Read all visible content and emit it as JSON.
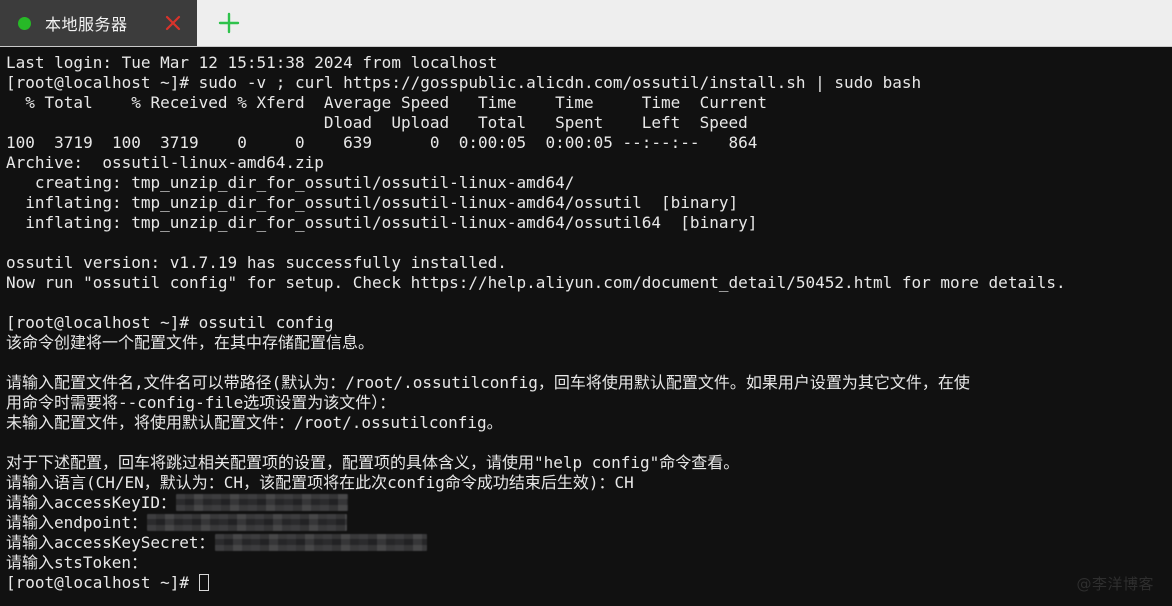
{
  "window": {
    "tab": {
      "title": "本地服务器",
      "status_dot_color": "#27b927",
      "close_label": "×",
      "new_tab_label": "+"
    }
  },
  "theme": {
    "tab_bar_bg": "#eeeeee",
    "active_tab_bg": "#3c3c3c",
    "terminal_bg": "#111111",
    "terminal_fg": "#e8e8e8",
    "close_icon_color": "#d9332b",
    "new_tab_icon_color": "#2ec24b"
  },
  "terminal": {
    "lines": [
      {
        "id": "l01",
        "text": "Last login: Tue Mar 12 15:51:38 2024 from localhost"
      },
      {
        "id": "l02",
        "text": "[root@localhost ~]# sudo -v ; curl https://gosspublic.alicdn.com/ossutil/install.sh | sudo bash"
      },
      {
        "id": "l03",
        "text": "  % Total    % Received % Xferd  Average Speed   Time    Time     Time  Current"
      },
      {
        "id": "l04",
        "text": "                                 Dload  Upload   Total   Spent    Left  Speed"
      },
      {
        "id": "l05",
        "text": "100  3719  100  3719    0     0    639      0  0:00:05  0:00:05 --:--:--   864"
      },
      {
        "id": "l06",
        "text": "Archive:  ossutil-linux-amd64.zip"
      },
      {
        "id": "l07",
        "text": "   creating: tmp_unzip_dir_for_ossutil/ossutil-linux-amd64/"
      },
      {
        "id": "l08",
        "text": "  inflating: tmp_unzip_dir_for_ossutil/ossutil-linux-amd64/ossutil  [binary]"
      },
      {
        "id": "l09",
        "text": "  inflating: tmp_unzip_dir_for_ossutil/ossutil-linux-amd64/ossutil64  [binary]"
      },
      {
        "id": "l10",
        "text": ""
      },
      {
        "id": "l11",
        "text": "ossutil version: v1.7.19 has successfully installed."
      },
      {
        "id": "l12",
        "text": "Now run \"ossutil config\" for setup. Check https://help.aliyun.com/document_detail/50452.html for more details."
      },
      {
        "id": "l13",
        "text": ""
      },
      {
        "id": "l14",
        "text": "[root@localhost ~]# ossutil config"
      },
      {
        "id": "l15",
        "text": "该命令创建将一个配置文件，在其中存储配置信息。"
      },
      {
        "id": "l16",
        "text": ""
      },
      {
        "id": "l17",
        "text": "请输入配置文件名,文件名可以带路径(默认为：/root/.ossutilconfig，回车将使用默认配置文件。如果用户设置为其它文件，在使"
      },
      {
        "id": "l18",
        "text": "用命令时需要将--config-file选项设置为该文件）："
      },
      {
        "id": "l19",
        "text": "未输入配置文件，将使用默认配置文件：/root/.ossutilconfig。"
      },
      {
        "id": "l20",
        "text": ""
      },
      {
        "id": "l21",
        "text": "对于下述配置，回车将跳过相关配置项的设置，配置项的具体含义，请使用\"help config\"命令查看。"
      },
      {
        "id": "l22",
        "text": "请输入语言(CH/EN，默认为：CH，该配置项将在此次config命令成功结束后生效)：CH"
      }
    ],
    "prompts": [
      {
        "id": "p1",
        "label": "请输入accessKeyID：",
        "value_redacted": true,
        "mask_class": "m1"
      },
      {
        "id": "p2",
        "label": "请输入endpoint：",
        "value_redacted": true,
        "mask_class": "m2"
      },
      {
        "id": "p3",
        "label": "请输入accessKeySecret：",
        "value_redacted": true,
        "mask_class": "m3"
      },
      {
        "id": "p4",
        "label": "请输入stsToken：",
        "value_redacted": false,
        "mask_class": ""
      }
    ],
    "final_prompt": "[root@localhost ~]# ",
    "cursor": "block"
  },
  "watermark": {
    "text": "@李洋博客"
  }
}
